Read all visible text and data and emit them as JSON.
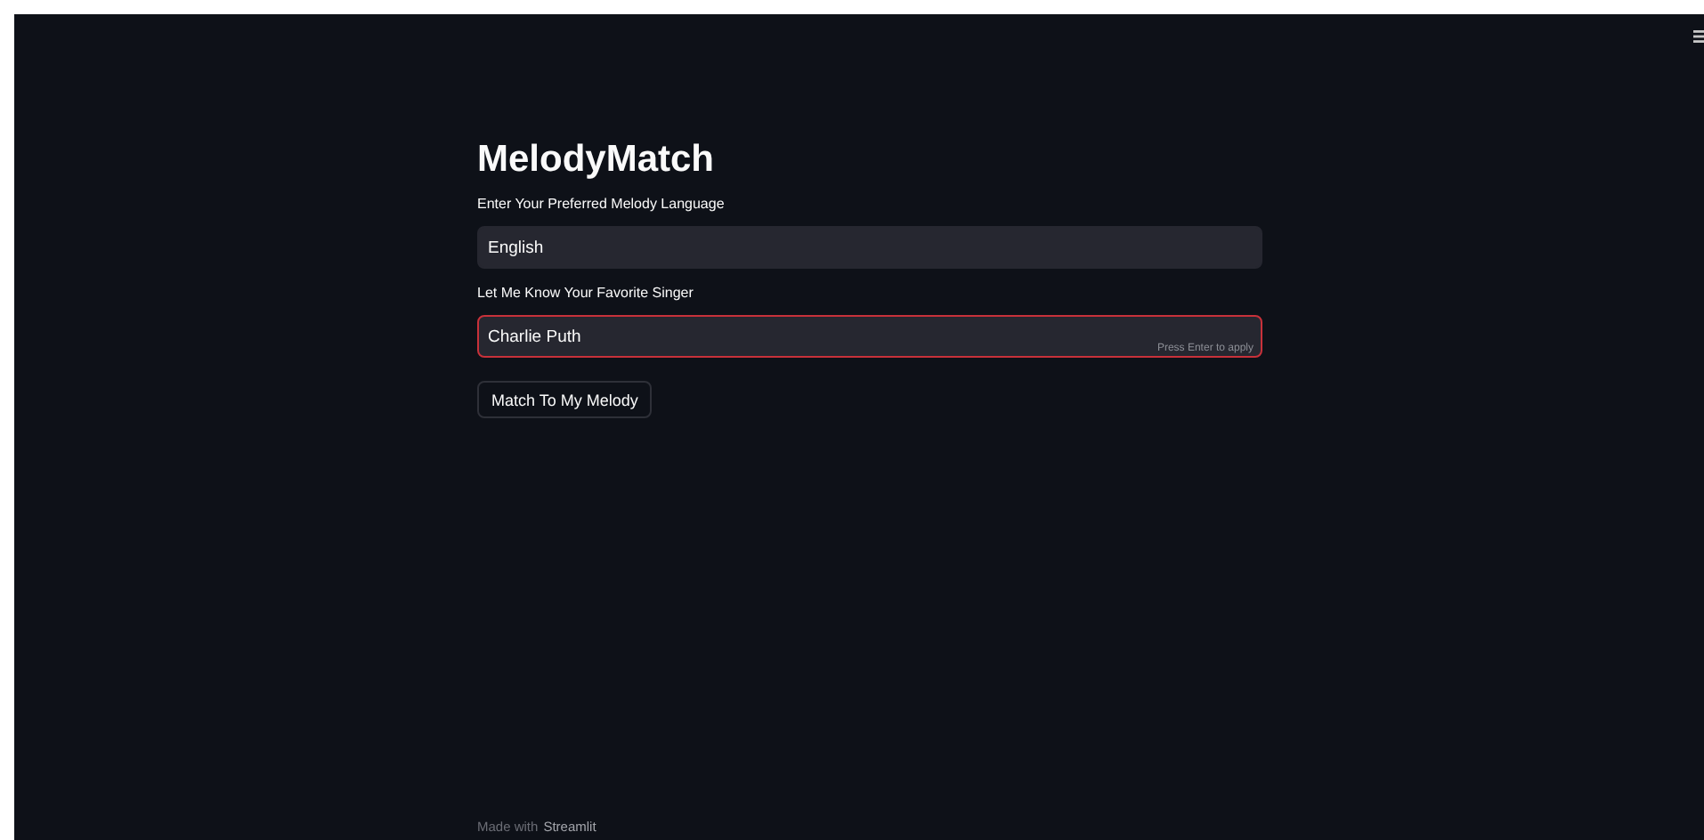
{
  "title": "MelodyMatch",
  "fields": [
    {
      "label": "Enter Your Preferred Melody Language",
      "value": "English",
      "focused": false
    },
    {
      "label": "Let Me Know Your Favorite Singer",
      "value": "Charlie Puth",
      "focused": true,
      "hint": "Press Enter to apply"
    }
  ],
  "button": "Match To My Melody",
  "footer": {
    "text": "Made with",
    "link": "Streamlit"
  }
}
